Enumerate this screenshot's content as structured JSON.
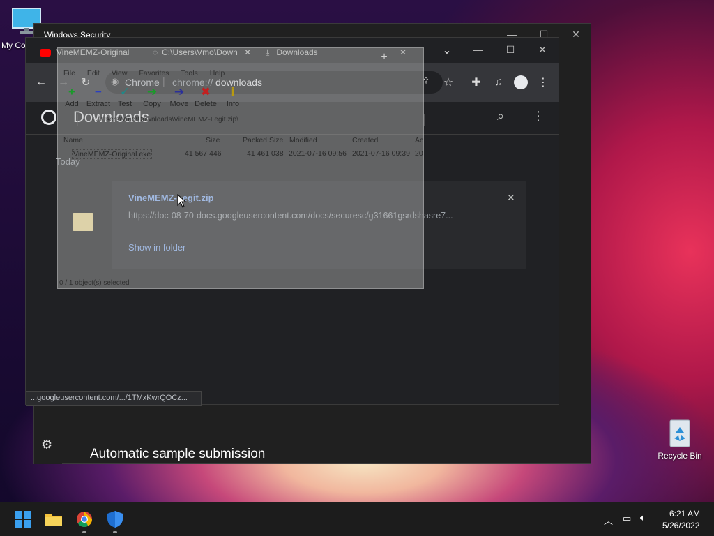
{
  "desktop": {
    "my_computer_label": "My Co",
    "recycle_bin_label": "Recycle Bin"
  },
  "security_window": {
    "title": "Windows Security",
    "bottom_text": "Automatic sample submission"
  },
  "chrome": {
    "tabs": [
      {
        "label": "VineMEMZ-Original"
      },
      {
        "label": "C:\\Users\\Vmo\\Downloads\\VineMEMZ-Legit.zip\\"
      },
      {
        "label": "Downloads"
      }
    ],
    "omnibox_scheme": "Chrome",
    "omnibox_url_prefix": "chrome://",
    "omnibox_url_path": "downloads",
    "page_title": "Downloads",
    "section_label": "Today",
    "download": {
      "filename": "VineMEMZ-Legit.zip",
      "url": "https://doc-08-70-docs.googleusercontent.com/docs/securesc/g31661gsrdshasre7...",
      "action": "Show in folder"
    },
    "status_bar": "...googleusercontent.com/.../1TMxKwrQOCz..."
  },
  "zip_window": {
    "menu": [
      "File",
      "Edit",
      "View",
      "Favorites",
      "Tools",
      "Help"
    ],
    "tools": [
      "Add",
      "Extract",
      "Test",
      "Copy",
      "Move",
      "Delete",
      "Info"
    ],
    "path": "C:\\Users\\Vmo\\Downloads\\VineMEMZ-Legit.zip\\",
    "columns": [
      "Name",
      "Size",
      "Packed Size",
      "Modified",
      "Created",
      "Ac"
    ],
    "rows": [
      {
        "name": "VineMEMZ-Original.exe",
        "size": "41 567 446",
        "packed": "41 461 038",
        "modified": "2021-07-16 09:56",
        "created": "2021-07-16 09:39",
        "accessed": "20"
      }
    ],
    "status": "0 / 1 object(s) selected"
  },
  "taskbar": {
    "time": "6:21 AM",
    "date": "5/26/2022"
  },
  "colors": {
    "accent_blue": "#8ab4f8",
    "taskbar": "#1c1c1c",
    "chrome_bg": "#202124"
  }
}
